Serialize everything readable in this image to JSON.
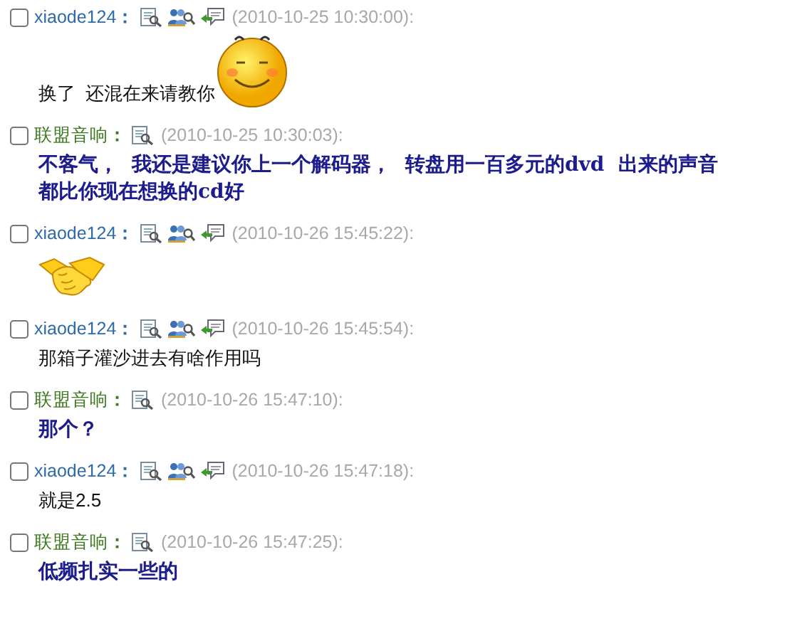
{
  "messages": [
    {
      "kind": "visitor",
      "author": "xiaode124",
      "separator": "：",
      "time": "(2010-10-25 10:30:00):",
      "body": "换了  还混在来请教你",
      "sticker": {
        "kind": "smile"
      },
      "checked": false
    },
    {
      "kind": "host",
      "author": "联盟音响",
      "separator": "：",
      "time": "(2010-10-25 10:30:03):",
      "body": "不客气，  我还是建议你上一个解码器，  转盘用一百多元的dvd  出来的声音都比你现在想换的cd好",
      "checked": false
    },
    {
      "kind": "visitor",
      "author": "xiaode124",
      "separator": "：",
      "time": "(2010-10-26 15:45:22):",
      "sticker": {
        "kind": "handshake"
      },
      "checked": false
    },
    {
      "kind": "visitor",
      "author": "xiaode124",
      "separator": "：",
      "time": "(2010-10-26 15:45:54):",
      "body": "那箱子灌沙进去有啥作用吗",
      "checked": false
    },
    {
      "kind": "host",
      "author": "联盟音响",
      "separator": "：",
      "time": "(2010-10-26 15:47:10):",
      "body": "那个？",
      "checked": false
    },
    {
      "kind": "visitor",
      "author": "xiaode124",
      "separator": "：",
      "time": "(2010-10-26 15:47:18):",
      "body": "就是2.5",
      "checked": false
    },
    {
      "kind": "host",
      "author": "联盟音响",
      "separator": "：",
      "time": "(2010-10-26 15:47:25):",
      "body": "低频扎实一些的",
      "checked": false
    }
  ]
}
